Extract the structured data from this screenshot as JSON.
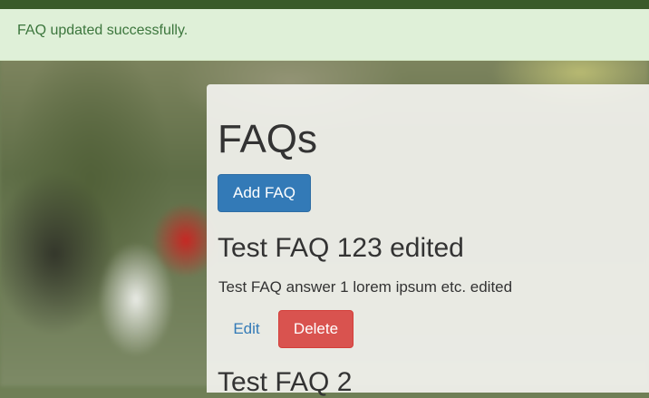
{
  "alert": {
    "message": "FAQ updated successfully."
  },
  "page": {
    "title": "FAQs",
    "add_button": "Add FAQ"
  },
  "faqs": [
    {
      "question": "Test FAQ 123 edited",
      "answer": "Test FAQ answer 1 lorem ipsum etc. edited",
      "edit_label": "Edit",
      "delete_label": "Delete"
    },
    {
      "question": "Test FAQ 2"
    }
  ],
  "colors": {
    "primary": "#337ab7",
    "danger": "#d9534f",
    "success_bg": "#dff0d8",
    "success_text": "#3c763d"
  }
}
